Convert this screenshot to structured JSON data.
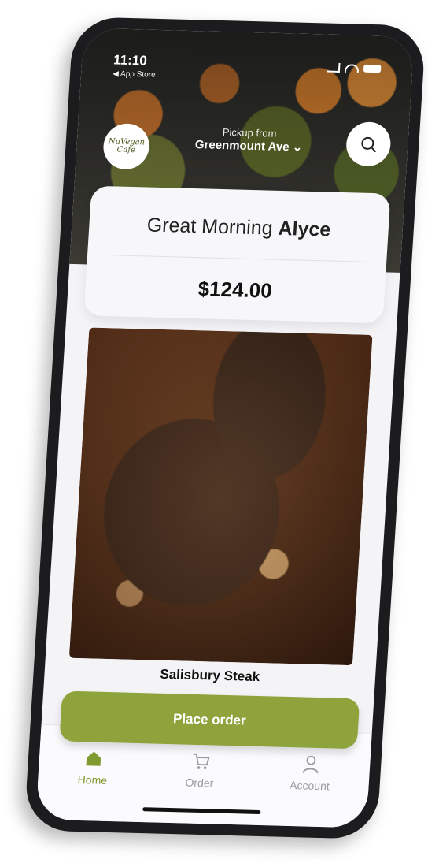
{
  "status": {
    "time": "11:10",
    "back_label": "◀ App Store"
  },
  "brand": {
    "logo_text": "NuVegan Cafe"
  },
  "pickup": {
    "label": "Pickup from",
    "location": "Greenmount Ave ⌄"
  },
  "greeting": {
    "prefix": "Great Morning ",
    "name": "Alyce"
  },
  "account": {
    "balance": "$124.00"
  },
  "featured": {
    "name": "Salisbury Steak"
  },
  "actions": {
    "place_order": "Place order"
  },
  "tabs": [
    {
      "label": "Home",
      "icon": "home-icon",
      "active": true
    },
    {
      "label": "Order",
      "icon": "cart-icon",
      "active": false
    },
    {
      "label": "Account",
      "icon": "user-icon",
      "active": false
    }
  ],
  "colors": {
    "accent": "#8ea33b",
    "active_tab": "#7f9a2e"
  }
}
